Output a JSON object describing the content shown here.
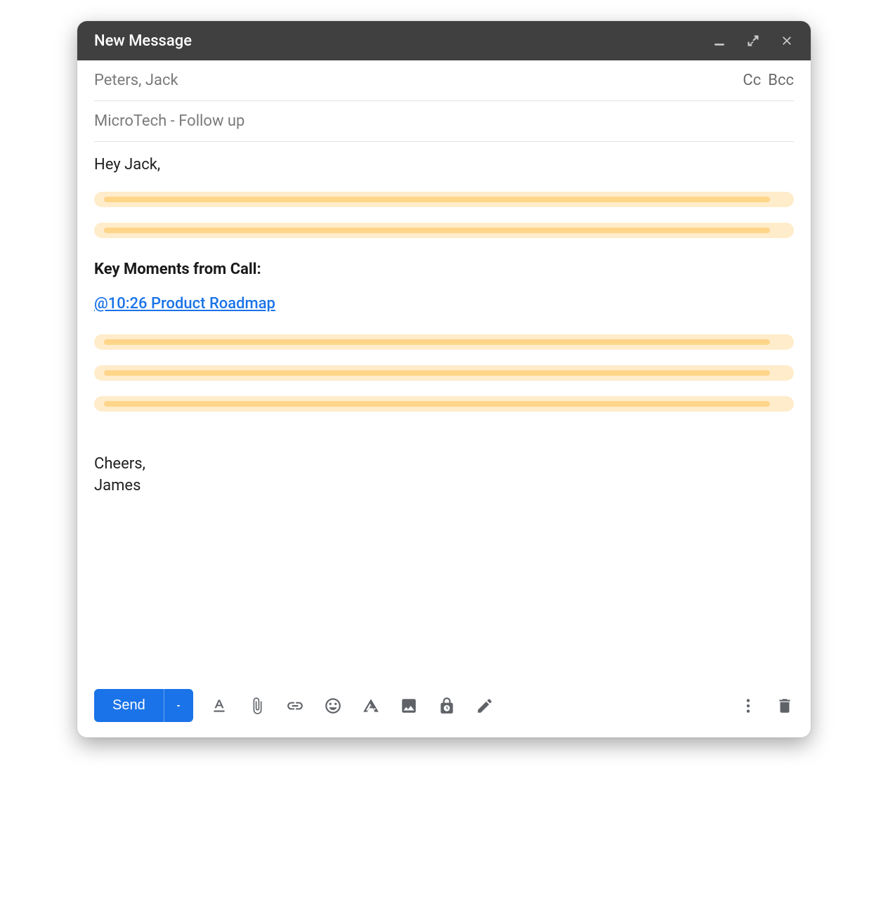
{
  "titlebar": {
    "title": "New Message"
  },
  "fields": {
    "to": "Peters, Jack",
    "cc_label": "Cc",
    "bcc_label": "Bcc",
    "subject": "MicroTech - Follow up"
  },
  "body": {
    "greeting": "Hey Jack,",
    "section_title": "Key Moments from Call:",
    "moment_link": "@10:26 Product Roadmap",
    "closing_line1": "Cheers,",
    "closing_line2": "James"
  },
  "toolbar": {
    "send_label": "Send"
  }
}
